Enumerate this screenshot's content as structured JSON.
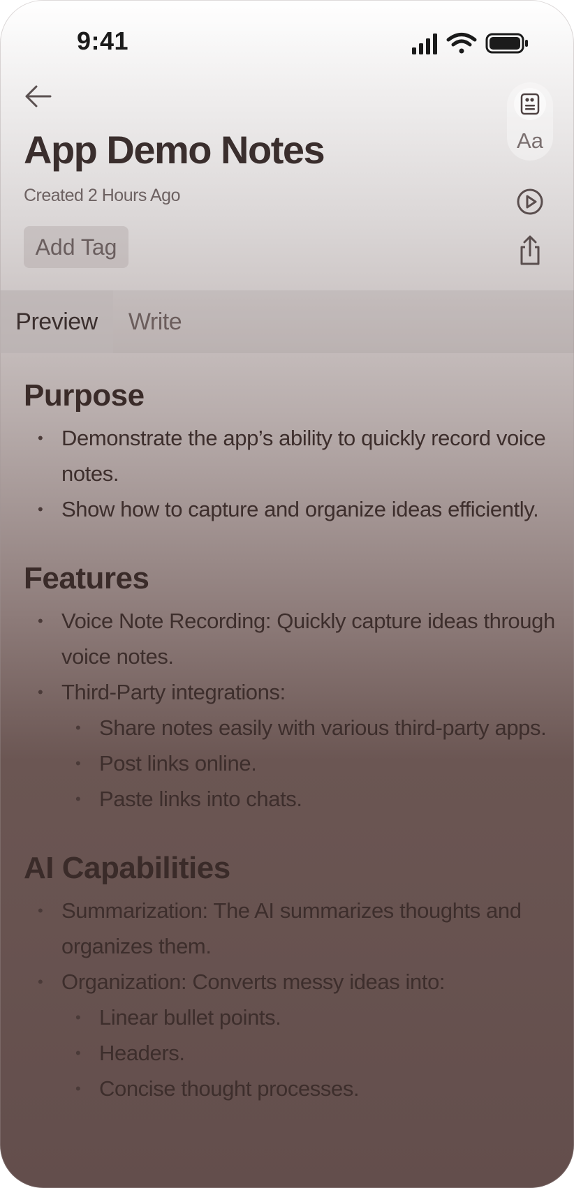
{
  "status_bar": {
    "time": "9:41",
    "icons": [
      "signal-icon",
      "wifi-icon",
      "battery-icon"
    ]
  },
  "header": {
    "title": "App Demo Notes",
    "created": "Created 2 Hours Ago",
    "add_tag_label": "Add Tag"
  },
  "toolbar": {
    "items": [
      "quote-icon",
      "text-size-label",
      "play-icon",
      "share-icon"
    ],
    "text_size_label": "Aa"
  },
  "tabs": {
    "items": [
      {
        "label": "Preview",
        "selected": true
      },
      {
        "label": "Write",
        "selected": false
      }
    ]
  },
  "sections": [
    {
      "heading": "Purpose",
      "items": [
        {
          "text": "Demonstrate the app’s ability to quickly record voice notes."
        },
        {
          "text": "Show how to capture and organize ideas efficiently."
        }
      ]
    },
    {
      "heading": "Features",
      "items": [
        {
          "text": "Voice Note Recording: Quickly capture ideas through voice notes."
        },
        {
          "text": "Third-Party integrations:",
          "children": [
            "Share notes easily with various third-party apps.",
            "Post links online.",
            "Paste links into chats."
          ]
        }
      ]
    },
    {
      "heading": "AI Capabilities",
      "items": [
        {
          "text": "Summarization: The AI summarizes thoughts and organizes them."
        },
        {
          "text": "Organization: Converts messy ideas into:",
          "children": [
            "Linear bullet points.",
            "Headers.",
            "Concise thought processes."
          ]
        }
      ]
    }
  ],
  "colors": {
    "heading_text": "#3a2b29",
    "title_text": "#3a2e2d",
    "background_bottom": "#634e4c"
  }
}
